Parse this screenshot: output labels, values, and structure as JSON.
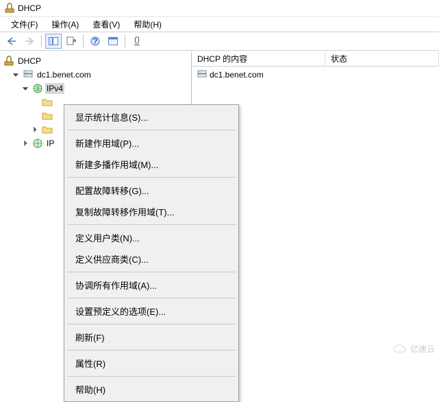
{
  "title": "DHCP",
  "menubar": {
    "file": "文件(F)",
    "action": "操作(A)",
    "view": "查看(V)",
    "help": "帮助(H)"
  },
  "tree": {
    "root": "DHCP",
    "server": "dc1.benet.com",
    "ipv4": "IPv4",
    "ipv6": "IP"
  },
  "columns": {
    "c1": "DHCP 的内容",
    "c2": "状态"
  },
  "list": {
    "row1": "dc1.benet.com"
  },
  "ctx": {
    "stats": "显示统计信息(S)...",
    "newscope": "新建作用域(P)...",
    "newmulticast": "新建多播作用域(M)...",
    "cfgfailover": "配置故障转移(G)...",
    "repfailover": "复制故障转移作用域(T)...",
    "userclass": "定义用户类(N)...",
    "vendorclass": "定义供应商类(C)...",
    "reconcile": "协调所有作用域(A)...",
    "predef": "设置预定义的选项(E)...",
    "refresh": "刷新(F)",
    "props": "属性(R)",
    "help": "帮助(H)"
  },
  "watermark": "亿速云"
}
